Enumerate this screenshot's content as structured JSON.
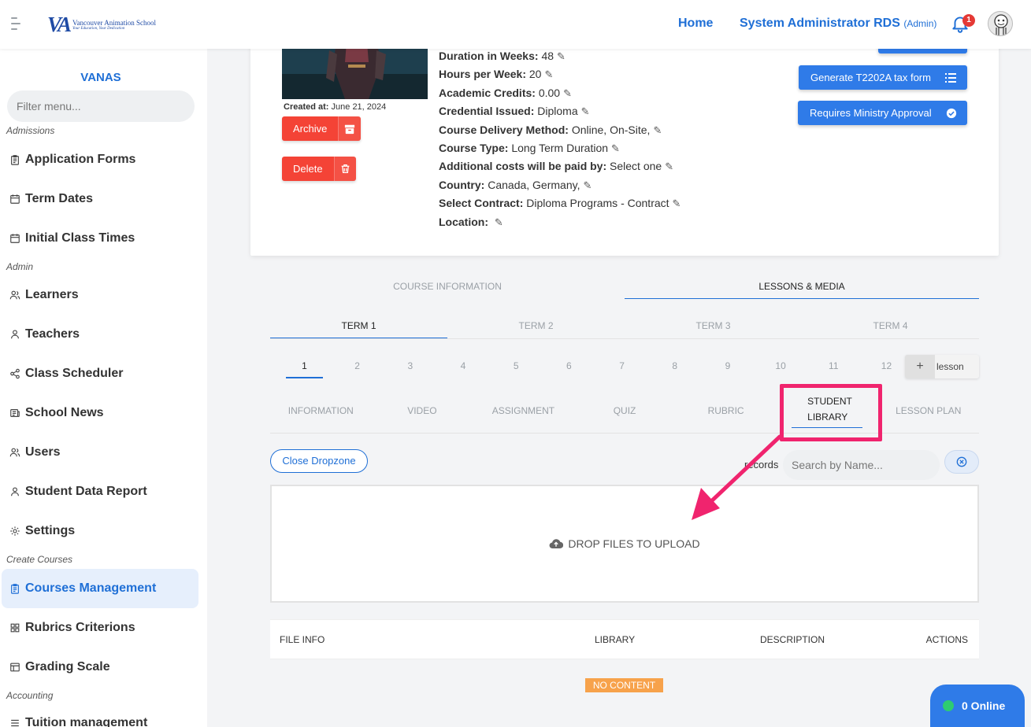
{
  "header": {
    "logo_mark": "VA",
    "logo_name": "Vancouver Animation School",
    "logo_tagline": "Your Education, Your Dedication",
    "home_link": "Home",
    "user_name": "System Administrator RDS",
    "user_role": "(Admin)",
    "notification_count": "1"
  },
  "sidebar": {
    "brand": "VANAS",
    "filter_placeholder": "Filter menu...",
    "sections": {
      "admissions": "Admissions",
      "admin": "Admin",
      "create_courses": "Create Courses",
      "accounting": "Accounting"
    },
    "items": [
      {
        "label": "Application Forms",
        "icon": "clipboard-icon"
      },
      {
        "label": "Term Dates",
        "icon": "calendar-icon"
      },
      {
        "label": "Initial Class Times",
        "icon": "calendar-icon"
      },
      {
        "label": "Learners",
        "icon": "users-icon"
      },
      {
        "label": "Teachers",
        "icon": "user-icon"
      },
      {
        "label": "Class Scheduler",
        "icon": "share-icon"
      },
      {
        "label": "School News",
        "icon": "newspaper-icon"
      },
      {
        "label": "Users",
        "icon": "users-icon"
      },
      {
        "label": "Student Data Report",
        "icon": "user-icon"
      },
      {
        "label": "Settings",
        "icon": "gear-icon"
      },
      {
        "label": "Courses Management",
        "icon": "clipboard-icon",
        "active": true
      },
      {
        "label": "Rubrics Criterions",
        "icon": "grid-icon"
      },
      {
        "label": "Grading Scale",
        "icon": "table-icon"
      },
      {
        "label": "Tuition management",
        "icon": "list-icon"
      }
    ]
  },
  "course": {
    "created_label": "Created at:",
    "created_value": "June 21, 2024",
    "archive_label": "Archive",
    "delete_label": "Delete",
    "details": [
      {
        "label": "Duration in Weeks:",
        "value": "48"
      },
      {
        "label": "Hours per Week:",
        "value": "20"
      },
      {
        "label": "Academic Credits:",
        "value": "0.00"
      },
      {
        "label": "Credential Issued:",
        "value": "Diploma"
      },
      {
        "label": "Course Delivery Method:",
        "value": "Online, On-Site,"
      },
      {
        "label": "Course Type:",
        "value": "Long Term Duration"
      },
      {
        "label": "Additional costs will be paid by:",
        "value": "Select one"
      },
      {
        "label": "Country:",
        "value": "Canada, Germany,"
      },
      {
        "label": "Select Contract:",
        "value": "Diploma Programs - Contract"
      },
      {
        "label": "Location:",
        "value": ""
      }
    ],
    "btn_t2202a": "Generate T2202A tax form",
    "btn_ministry": "Requires Ministry Approval"
  },
  "tabs": {
    "main": [
      "COURSE INFORMATION",
      "LESSONS & MEDIA"
    ],
    "terms": [
      "TERM 1",
      "TERM 2",
      "TERM 3",
      "TERM 4"
    ],
    "lessons": [
      "1",
      "2",
      "3",
      "4",
      "5",
      "6",
      "7",
      "8",
      "9",
      "10",
      "11",
      "12"
    ],
    "add_lesson_plus": "+",
    "add_lesson_label": "lesson",
    "sub": [
      "INFORMATION",
      "VIDEO",
      "ASSIGNMENT",
      "QUIZ",
      "RUBRIC",
      "STUDENT LIBRARY",
      "LESSON PLAN"
    ]
  },
  "library": {
    "close_dropzone": "Close Dropzone",
    "records_label": "records",
    "search_placeholder": "Search by Name...",
    "dropzone_text": "DROP FILES TO UPLOAD",
    "columns": [
      "FILE INFO",
      "LIBRARY",
      "DESCRIPTION",
      "ACTIONS"
    ],
    "no_content": "NO CONTENT"
  },
  "online": {
    "label": "0 Online"
  },
  "colors": {
    "primary": "#1f6fd6",
    "button_blue": "#2f7be8",
    "danger": "#f44336",
    "highlight": "#f0246e",
    "warning": "#f7a24b",
    "online_dot": "#2ecc71"
  }
}
